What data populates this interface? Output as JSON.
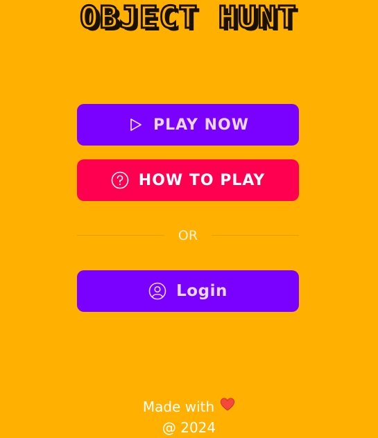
{
  "title": "OBJECT HUNT",
  "buttons": {
    "play": {
      "label": "PLAY NOW",
      "icon": "play-icon"
    },
    "how_to_play": {
      "label": "HOW TO PLAY",
      "icon": "question-circle-icon"
    },
    "login": {
      "label": "Login",
      "icon": "user-circle-icon"
    }
  },
  "divider": {
    "text": "OR"
  },
  "footer": {
    "made_with": "Made with",
    "heart_icon": "heart-icon",
    "year": "@ 2024"
  },
  "colors": {
    "background": "#FFB000",
    "primary": "#7A00FF",
    "secondary": "#FF0050"
  }
}
